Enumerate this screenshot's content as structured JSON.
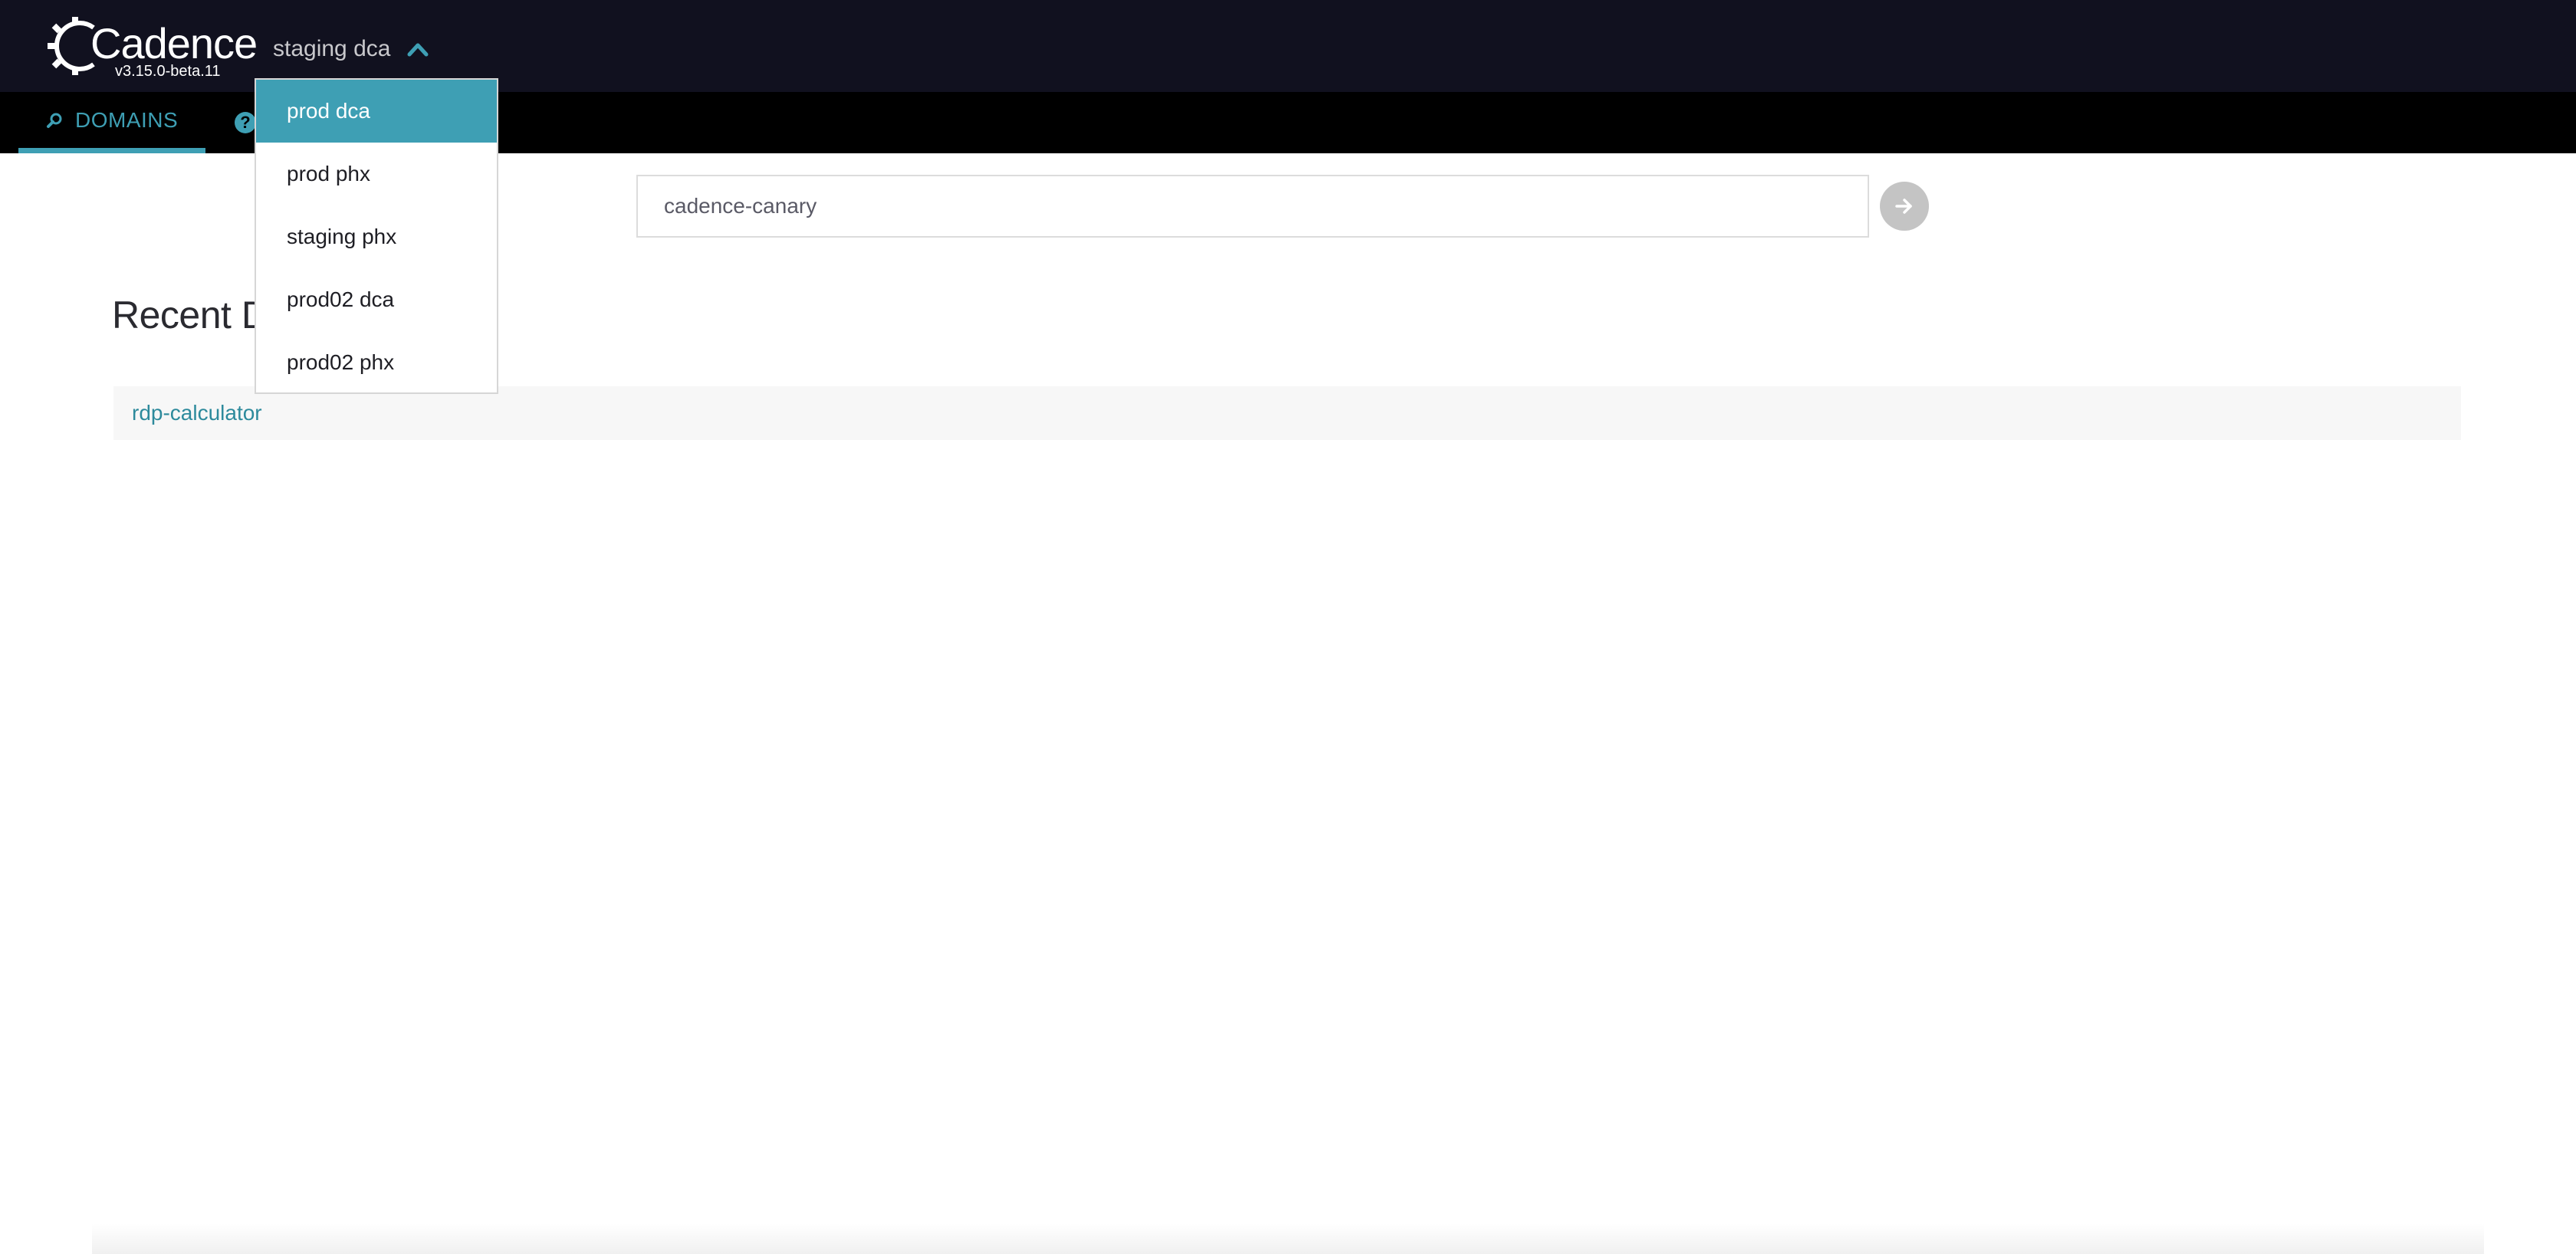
{
  "header": {
    "logo_text": "Cadence",
    "version": "v3.15.0-beta.11",
    "env_selected": "staging dca"
  },
  "nav": {
    "domains_label": "DOMAINS",
    "help_glyph": "?"
  },
  "env_dropdown": {
    "options": [
      "prod dca",
      "prod phx",
      "staging phx",
      "prod02 dca",
      "prod02 phx"
    ],
    "highlighted": "prod dca"
  },
  "search": {
    "value": "cadence-canary"
  },
  "recent": {
    "title": "Recent Domains",
    "items": [
      "rdp-calculator"
    ]
  },
  "colors": {
    "header_bg": "#11111f",
    "nav_bg": "#000000",
    "accent": "#3e9fb4",
    "link": "#2d8a9c"
  },
  "icons": {
    "logo": "cadence-gear-icon",
    "env_toggle": "chevron-up-icon",
    "domains_tab": "search-icon",
    "help_tab": "help-circle-icon",
    "search_submit": "arrow-right-icon"
  }
}
